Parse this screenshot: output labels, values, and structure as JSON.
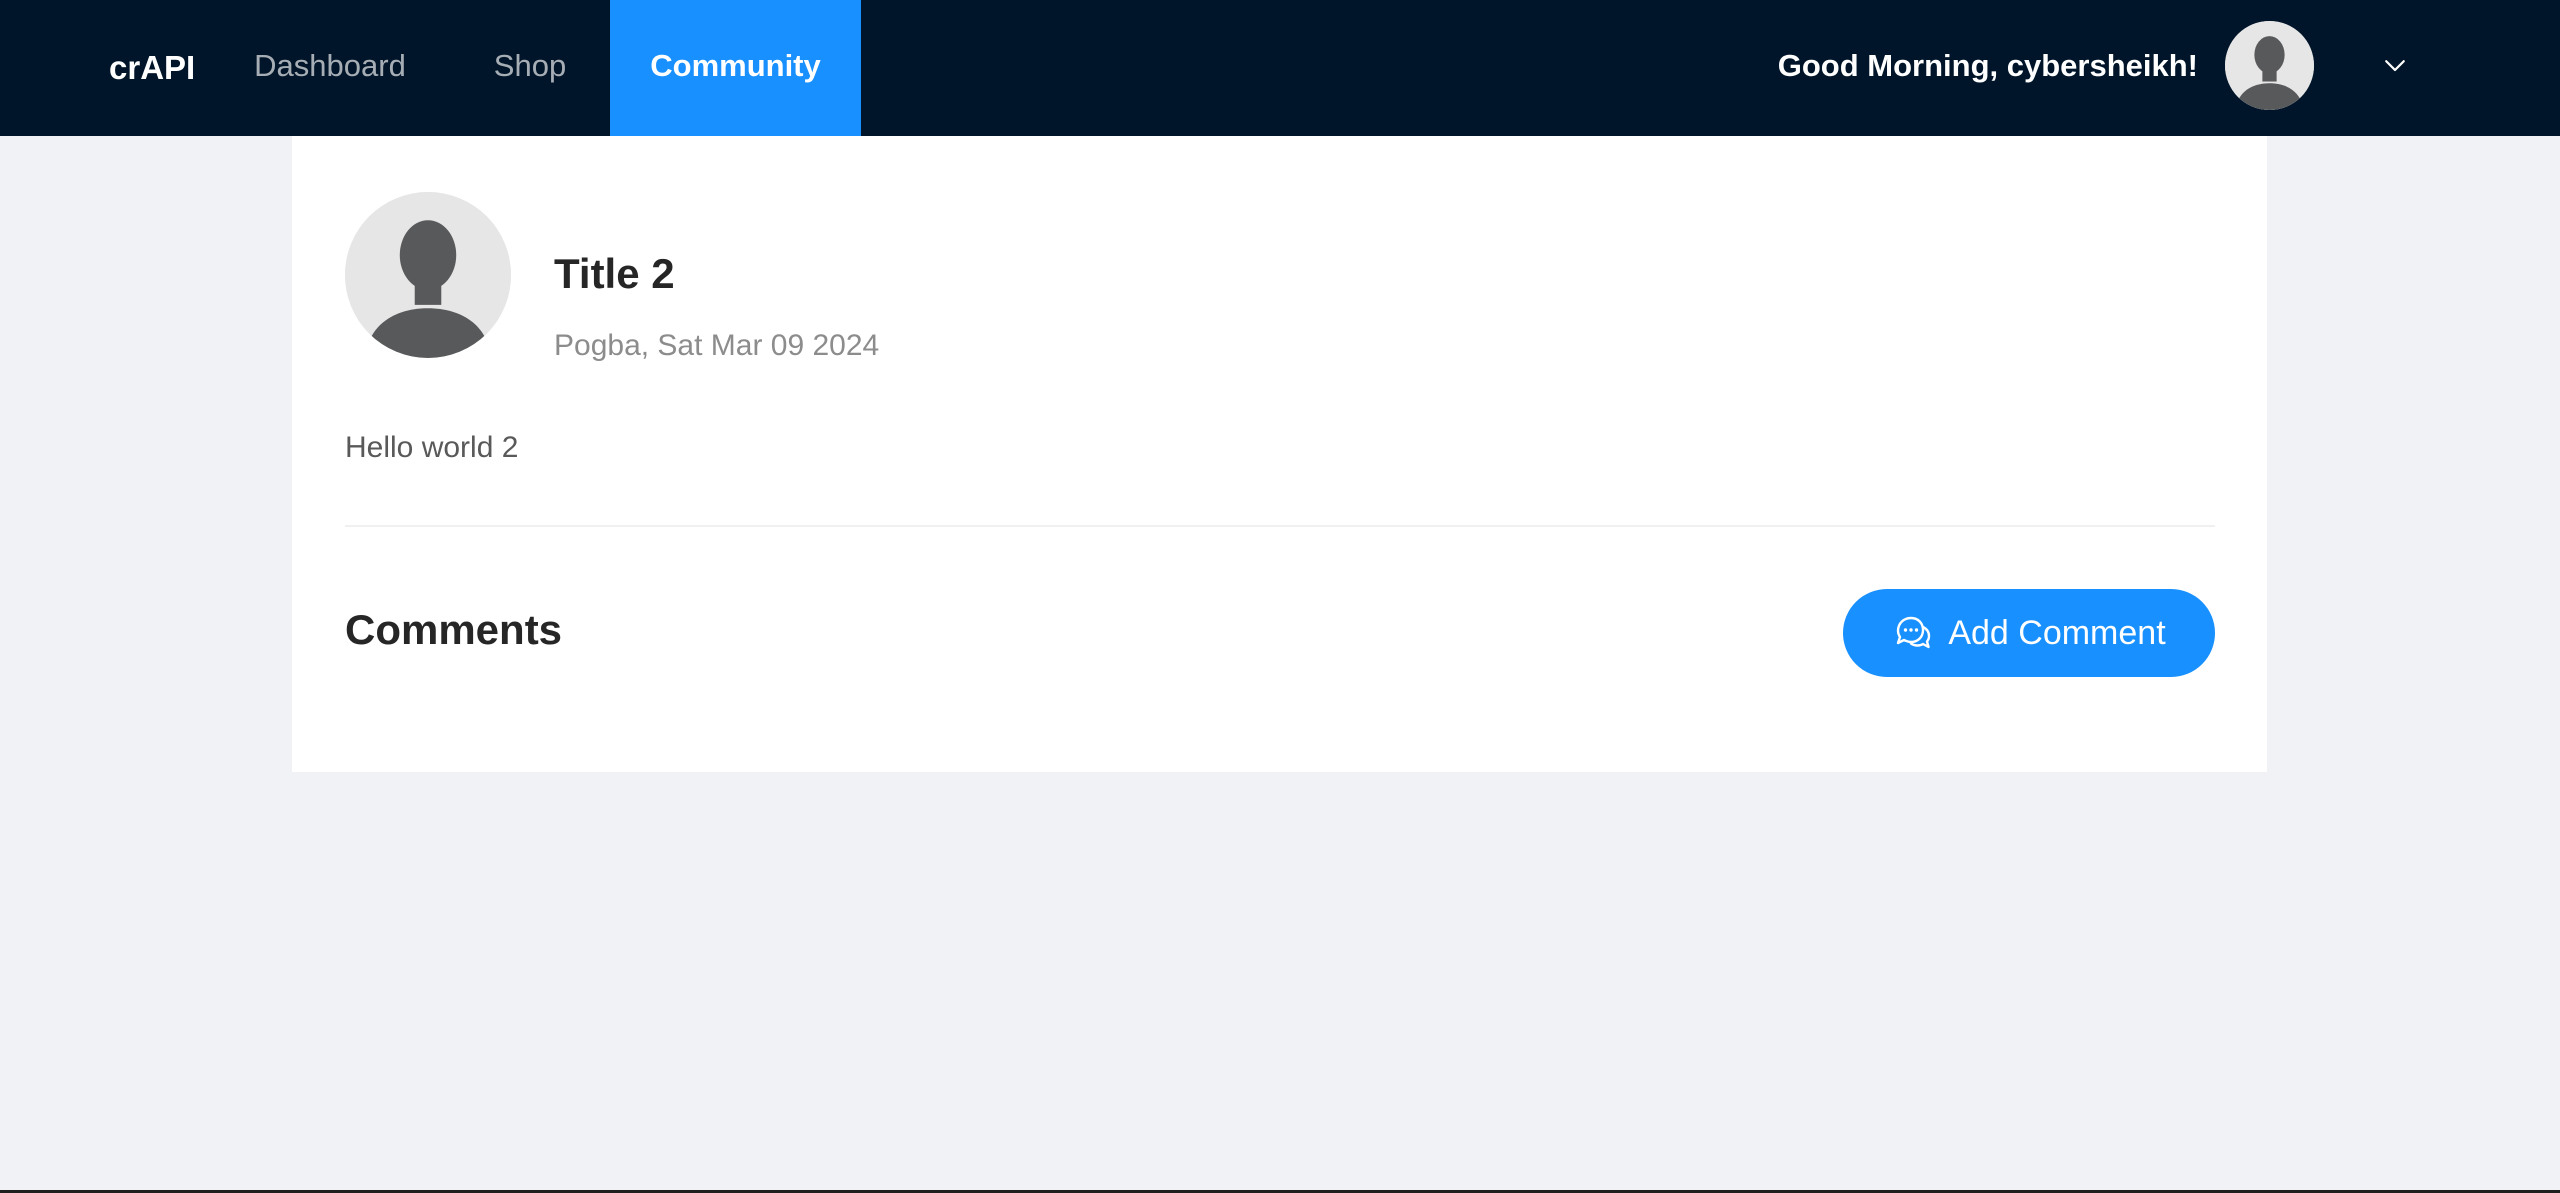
{
  "header": {
    "logo": "crAPI",
    "nav": [
      {
        "label": "Dashboard",
        "active": false
      },
      {
        "label": "Shop",
        "active": false
      },
      {
        "label": "Community",
        "active": true
      }
    ],
    "greeting": "Good Morning, cybersheikh!",
    "avatar_icon": "user-avatar-icon",
    "menu_icon": "chevron-down-icon"
  },
  "post": {
    "avatar_icon": "user-avatar-icon",
    "title": "Title 2",
    "meta": "Pogba, Sat Mar 09 2024",
    "content": "Hello world 2"
  },
  "comments": {
    "heading": "Comments",
    "add_label": "Add Comment",
    "add_icon": "comment-icon"
  },
  "colors": {
    "header_bg": "#001529",
    "accent": "#1890ff",
    "page_bg": "#f0f2f5"
  }
}
